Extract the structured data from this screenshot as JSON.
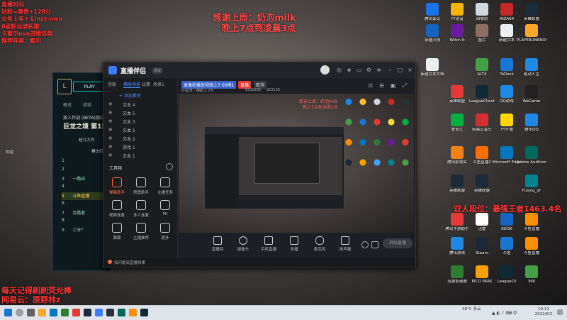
{
  "overlay_top_left": [
    "直播时间",
    "钻粉=唐僧+128分",
    "业务上车+ Linzz-owo",
    "6级粉丝牌私聊",
    "卡蜜尔ovo进微信群",
    "推荐阵容：索尔"
  ],
  "overlay_top_center": [
    "感谢上周：奶泡milk",
    "晚上7点到凌晨3点"
  ],
  "overlay_rank": "双人段位：最强王者1463.4名",
  "overlay_bottom_left": [
    "每天记得刷刷荧光棒",
    "网易云：原野林z"
  ],
  "game_client": {
    "play_label": "PLAY",
    "nav": [
      "概览",
      "成就"
    ],
    "event_title": "双人作战 (BETA)测试",
    "event_sub": "巨龙之境 第1章",
    "rank_label": "超凡大师",
    "column_header": "棋士们",
    "rows": [
      "1",
      "2",
      "3",
      "4",
      "5",
      "6",
      "7",
      "8",
      "9"
    ],
    "row_names": [
      "",
      "",
      "一路自",
      "",
      "斗鱼直播",
      "",
      "百路者",
      "",
      "上分？"
    ],
    "welcome": "欢迎"
  },
  "app": {
    "title": "直播伴侣",
    "version": "测试",
    "sidebar_tabs": [
      "竖版",
      "横版场景",
      "比赛",
      "场景1"
    ],
    "add_scene": "+ 添加素材",
    "layers": [
      "文本 4",
      "文本 5",
      "文本 3",
      "文本 1",
      "文本 2",
      "游戏 1",
      "文本 1"
    ],
    "toolbox_label": "工具箱",
    "tools": [
      "弹幕助手",
      "房管助手",
      "主播任务",
      "视频连麦",
      "多人连麦",
      "PK",
      "弹幕",
      "主播推荐",
      "更多"
    ],
    "preview_title": "录像和播放视频上7:00棒1",
    "preview_status": "直播",
    "preview_status2": "取消",
    "preview_bar_text": "lol总览 : 捕捉上 2分",
    "preview_counters": [
      "6216285",
      "222135"
    ],
    "bottom_buttons": [
      "直播间",
      "摄像头",
      "手机直播",
      "多播",
      "麦克风",
      "扬声器"
    ],
    "start_button": "开始直播",
    "status_text": "如何提高直播效果",
    "preview_overlay": [
      "感谢上周：奶泡milk",
      "晚上7点到凌晨3点"
    ]
  },
  "desktop_icons": [
    {
      "label": "腾讯会议",
      "color": "#1a73e8"
    },
    {
      "label": "YY语音",
      "color": "#f2b400"
    },
    {
      "label": "回收站",
      "color": "#cfd8dc"
    },
    {
      "label": "AIDA64",
      "color": "#c62828"
    },
    {
      "label": "英雄联盟",
      "color": "#1c2b3a"
    },
    {
      "label": "英雄联盟WeGame",
      "color": "#263238"
    },
    {
      "label": "穿越火线",
      "color": "#1565c0"
    },
    {
      "label": "Witch It",
      "color": "#6a1b9a"
    },
    {
      "label": "图片",
      "color": "#8d6e63"
    },
    {
      "label": "新建文本",
      "color": "#eceff1"
    },
    {
      "label": "PLAYERUNKNOWN",
      "color": "#f9a825"
    },
    {
      "label": "Wallpaper Engine",
      "color": "#37474f"
    },
    {
      "label": "新建文本文档",
      "color": "#eceff1"
    },
    {
      "label": "ALT4",
      "color": "#43a047"
    },
    {
      "label": "ToDesk",
      "color": "#1976d2"
    },
    {
      "label": "驱动人生",
      "color": "#1e88e5"
    },
    {
      "label": "英雄联盟",
      "color": "#1c2b3a"
    },
    {
      "label": "英雄联盟",
      "color": "#e53935"
    },
    {
      "label": "LeagueClient",
      "color": "#0f2a36"
    },
    {
      "label": "QQ游戏",
      "color": "#1e88e5"
    },
    {
      "label": "WeGame",
      "color": "#212121"
    },
    {
      "label": "QQ音乐",
      "color": "#fbc02d"
    },
    {
      "label": "爱奇艺",
      "color": "#00b140"
    },
    {
      "label": "网易云音乐",
      "color": "#d32f2f"
    },
    {
      "label": "YY开播",
      "color": "#ffd600"
    },
    {
      "label": "腾讯QQ",
      "color": "#1e88e5"
    },
    {
      "label": "微信",
      "color": "#2e7d32"
    },
    {
      "label": "腾讯影视库",
      "color": "#f57f17"
    },
    {
      "label": "斗鱼直播2",
      "color": "#ff6f00"
    },
    {
      "label": "Microsoft Edge",
      "color": "#0277bd"
    },
    {
      "label": "Adobe Audition",
      "color": "#00695c"
    },
    {
      "label": "此电脑",
      "color": "#42a5f5"
    },
    {
      "label": "英雄联盟",
      "color": "#1c2b3a"
    },
    {
      "label": "英雄联盟",
      "color": "#1c2b3a"
    },
    {
      "label": "Fusing_dr",
      "color": "#00838f"
    },
    {
      "label": "AppData",
      "color": "#fbc02d"
    },
    {
      "label": "腾讯手游助手",
      "color": "#e53935"
    },
    {
      "label": "迅雷",
      "color": "#ffffff"
    },
    {
      "label": "KOOK",
      "color": "#1565c0"
    },
    {
      "label": "斗鱼直播",
      "color": "#ff8f00"
    },
    {
      "label": "ELL",
      "color": "#fdd835"
    },
    {
      "label": "腾讯游戏",
      "color": "#1e88e5"
    },
    {
      "label": "Steam",
      "color": "#1b2838"
    },
    {
      "label": "斗鱼",
      "color": "#1976d2"
    },
    {
      "label": "斗鱼直播",
      "color": "#ff8f00"
    },
    {
      "label": "腾讯视频",
      "color": "#ff7043"
    },
    {
      "label": "迅游加速器",
      "color": "#2e7d32"
    },
    {
      "label": "PICO PARK",
      "color": "#ffa000"
    },
    {
      "label": "LeagueCli",
      "color": "#0f2a36"
    },
    {
      "label": "360",
      "color": "#43a047"
    }
  ],
  "taskbar": {
    "weather": "48°C 多云",
    "time": "19:11",
    "date": "2022/6/2"
  }
}
